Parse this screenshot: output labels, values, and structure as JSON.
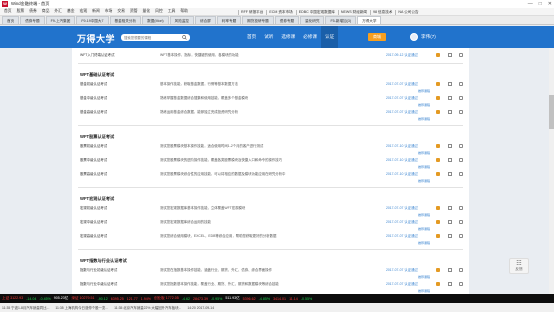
{
  "window": {
    "title": "Wind金融终端 - 首页",
    "controls": [
      "—",
      "□",
      "✕"
    ]
  },
  "menu": {
    "items": [
      "首页",
      "股票",
      "债券",
      "商品",
      "外汇",
      "基金",
      "宏观",
      "新闻",
      "市场",
      "交易",
      "资管",
      "量化",
      "风控",
      "工具",
      "帮助"
    ],
    "right_links": [
      "RFF 研报平台",
      "ECM 资本市场",
      "EDBC 中国宏观数据库",
      "NEWS 财经新闻",
      "98 信息技术",
      "NA 公司公告"
    ]
  },
  "tabs": [
    "首页",
    "债券专题",
    "F9-上汽集团",
    "F9-19中国大7",
    "基金相关分析",
    "数据(Mori)",
    "风险监控",
    "综合屏",
    "利率专题",
    "期货投研专题",
    "债券专题",
    "量化研究",
    "F5-新增加(3)",
    "万得大学"
  ],
  "header": {
    "brand": "万得大学",
    "search_placeholder": "搜索您想要的课程",
    "nav": [
      "首页",
      "试听",
      "选修课",
      "必修课",
      "认证"
    ],
    "active_nav": "认证",
    "orange_button": "商城",
    "username": "李伟(7)"
  },
  "rows": [
    {
      "section": null,
      "name": "WFT入门终端认证考试",
      "desc": "WFT基本操作，指标，快捷键的使用，各模块的功能",
      "date": "2017-09-12 认证通过",
      "link": ""
    },
    {
      "section": "WFT基础认证考试"
    },
    {
      "name": "基金初级认证考试",
      "desc": "基本操作技能，获取基金数据，行情等基本数据方法",
      "date": "2017-07-07 认证通过",
      "link": "推荐课程"
    },
    {
      "name": "基金中级认证考试",
      "desc": "熟练掌握基金数据综合搜集和使用技能，覆盖多个基金模块",
      "date": "2017-07-07 认证通过",
      "link": "推荐课程"
    },
    {
      "name": "基金高级认证考试",
      "desc": "熟练运用基金综合数据，能够独立完成投资研究分析",
      "date": "2017-07-07 认证通过",
      "link": "推荐课程"
    },
    {
      "section": "WFT股票认证考试"
    },
    {
      "name": "股票初级认证考试",
      "desc": "测试您股票模块基本操作技能，适合使用时间1-2个月的客户进行测试",
      "date": "2017-07-10 认证通过",
      "link": "推荐课程"
    },
    {
      "name": "股票中级认证考试",
      "desc": "测试您股票模块的进阶操作技能，覆盖各类股票模块及快捷入口和命令的操作技巧",
      "date": "2017-07-10 认证通过",
      "link": "推荐课程"
    },
    {
      "name": "股票高级认证考试",
      "desc": "测试您股票模块综合性的应用技能，可以将相应的数据及模块功能应用在研究分析中",
      "date": "2017-07-10 认证通过",
      "link": "推荐课程"
    },
    {
      "section": "WFT宏观认证考试"
    },
    {
      "name": "宏观初级认证考试",
      "desc": "测试您宏观数据库基本操作技能，立体覆盖WFT宏观模块",
      "date": "2017-07-07 认证通过",
      "link": "推荐课程"
    },
    {
      "name": "宏观中级认证考试",
      "desc": "测试您宏观数据库综合运用的技能",
      "date": "2017-07-07 认证通过",
      "link": "推荐课程"
    },
    {
      "name": "宏观高级认证考试",
      "desc": "测试您综合使用模块，EXCEL，EDB等综合应用，帮助您获取更好的分析数据",
      "date": "2017-07-07 认证通过",
      "link": "推荐课程"
    },
    {
      "section": "WFT指数与行业认证考试"
    },
    {
      "name": "指数与行业初级认证考试",
      "desc": "测试您在指数基本操作技能，涵盖行业、期货、外汇、债券、综合界面操作",
      "date": "2017-07-07 认证通过",
      "link": "推荐课程"
    },
    {
      "name": "指数与行业中级认证考试",
      "desc": "测试您指数基本操作技能，覆盖行业、期货、外汇、期货和数据模块等综合技能",
      "date": "2017-07-07 认证通过",
      "link": "推荐课程"
    },
    {
      "name": "指数与行业高级认证考试",
      "desc": "测试您综合运用以及研究技能，覆盖多个模块以及数据综合分析能力",
      "date": "2017-07-07 认证通过",
      "link": "推荐课程"
    }
  ],
  "float_button": "反馈",
  "ticker": [
    {
      "t": "上证 3122.93",
      "c": "red"
    },
    {
      "t": "-14.04",
      "c": "green"
    },
    {
      "t": "-0.45%",
      "c": "green"
    },
    {
      "t": "905.23亿",
      "c": ""
    },
    {
      "t": "深证 10279.51",
      "c": "red"
    },
    {
      "t": "-90.12",
      "c": "green"
    },
    {
      "t": "6395.25",
      "c": "red"
    },
    {
      "t": "121.77",
      "c": "red"
    },
    {
      "t": "1.94%",
      "c": "red"
    },
    {
      "t": "创业板 1772.05",
      "c": "red"
    },
    {
      "t": "-4.62",
      "c": "green"
    },
    {
      "t": "28473.39",
      "c": "red"
    },
    {
      "t": "-0.95%",
      "c": "green"
    },
    {
      "t": "511.93亿",
      "c": ""
    },
    {
      "t": "5396.62",
      "c": "red"
    },
    {
      "t": "-4.85%",
      "c": "green"
    },
    {
      "t": "3414.01",
      "c": "red"
    },
    {
      "t": "11.14",
      "c": "red"
    },
    {
      "t": "-0.55%",
      "c": "green"
    }
  ],
  "status": [
    "11:35  宁波1-8月汽车销量同比...",
    "11:35  上海机构今日涨停个股一览...",
    "11:35  北京汽车销量22%  大幅回升汽车板块...",
    "14:20  2017-09-14"
  ]
}
